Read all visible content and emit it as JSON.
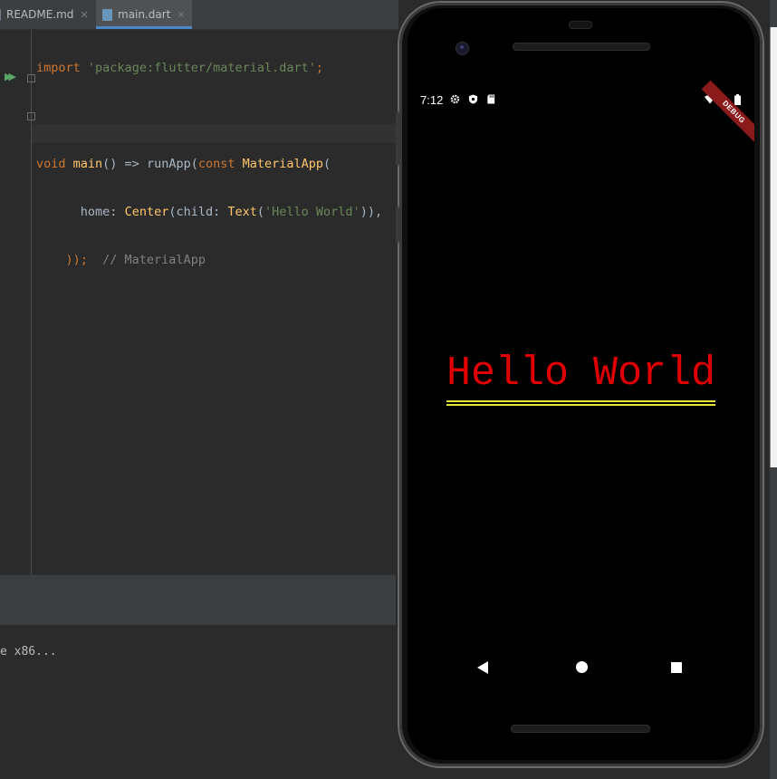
{
  "tabs": [
    {
      "label": "README.md",
      "active": false
    },
    {
      "label": "main.dart",
      "active": true
    }
  ],
  "code": {
    "line1": {
      "kw": "import",
      "str": "'package:flutter/material.dart'",
      "end": ";"
    },
    "line3": {
      "kw1": "void",
      "fn": "main",
      "mid": "() => runApp(",
      "kw2": "const",
      "cls": "MaterialApp",
      "end": "("
    },
    "line4": {
      "indent": "      ",
      "p1": "home: ",
      "cls1": "Center",
      "p2": "(child: ",
      "cls2": "Text",
      "p3": "(",
      "str": "'Hello World'",
      "p4": ")),"
    },
    "line5": {
      "indent": "    ",
      "p1": "));  ",
      "cmt": "// MaterialApp"
    }
  },
  "console": {
    "text": "e x86..."
  },
  "phone": {
    "status_time": "7:12",
    "debug_banner": "DEBUG",
    "hello_text": "Hello World",
    "colors": {
      "text": "#e00000",
      "underline": "#e5e537",
      "background": "#000000"
    }
  },
  "icons": {
    "settings": "gear-icon",
    "shield": "shield-icon",
    "sd": "sd-card-icon",
    "wifi": "wifi-icon",
    "signal": "signal-icon",
    "battery": "battery-icon",
    "back": "back-triangle-icon",
    "home": "home-circle-icon",
    "recent": "recents-square-icon"
  }
}
